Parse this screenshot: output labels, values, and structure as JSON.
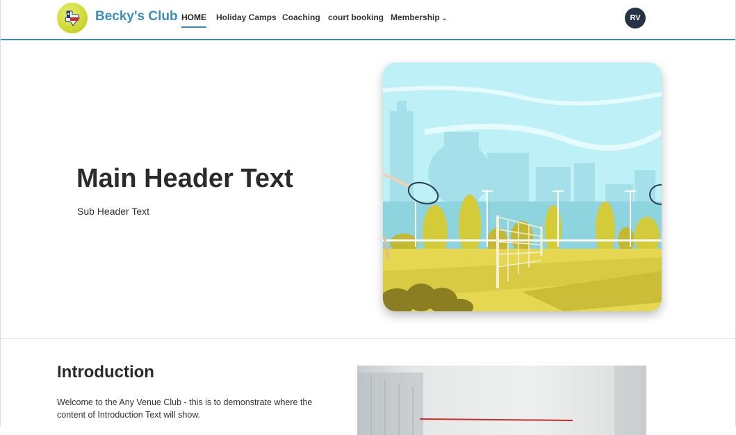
{
  "header": {
    "brand": "Becky's Club",
    "nav": [
      {
        "label": "HOME"
      },
      {
        "label": "Holiday Camps"
      },
      {
        "label": "Coaching"
      },
      {
        "label": "court booking"
      },
      {
        "label": "Membership"
      }
    ],
    "avatar_initials": "RV",
    "accent_color": "#3b8bb9",
    "brand_color": "#3a8fc0"
  },
  "hero": {
    "title": "Main Header Text",
    "subtitle": "Sub Header Text",
    "image_icon": "tennis-court-illustration"
  },
  "intro": {
    "title": "Introduction",
    "text": "Welcome to the Any Venue Club - this is to demonstrate where the content of Introduction Text will show.",
    "image_icon": "squash-court-photo"
  }
}
